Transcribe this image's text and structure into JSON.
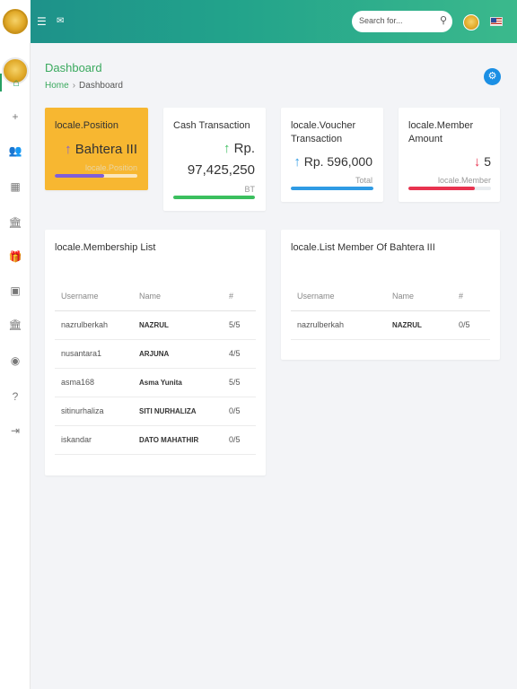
{
  "topbar": {
    "menu_icon": "hamburger-icon",
    "mail_icon": "mail-icon",
    "search_placeholder": "Search for...",
    "search_icon": "search-icon",
    "flag_icon": "us-flag-icon"
  },
  "sidebar": {
    "items": [
      {
        "name": "sidebar-item-home",
        "icon": "home-icon",
        "glyph": "⌂",
        "active": true
      },
      {
        "name": "sidebar-item-add-user",
        "icon": "add-user-icon",
        "glyph": "+",
        "active": false
      },
      {
        "name": "sidebar-item-users",
        "icon": "users-icon",
        "glyph": "👥",
        "active": false
      },
      {
        "name": "sidebar-item-calculator",
        "icon": "calculator-icon",
        "glyph": "▦",
        "active": false
      },
      {
        "name": "sidebar-item-bank",
        "icon": "bank-icon",
        "glyph": "🏛",
        "active": false
      },
      {
        "name": "sidebar-item-gift",
        "icon": "gift-icon",
        "glyph": "🎁",
        "active": false
      },
      {
        "name": "sidebar-item-document",
        "icon": "document-icon",
        "glyph": "▣",
        "active": false
      },
      {
        "name": "sidebar-item-institution",
        "icon": "institution-icon",
        "glyph": "🏛",
        "active": false
      },
      {
        "name": "sidebar-item-account",
        "icon": "account-icon",
        "glyph": "◉",
        "active": false
      },
      {
        "name": "sidebar-item-help",
        "icon": "help-icon",
        "glyph": "?",
        "active": false
      },
      {
        "name": "sidebar-item-logout",
        "icon": "logout-icon",
        "glyph": "⇥",
        "active": false
      }
    ]
  },
  "header": {
    "title": "Dashboard",
    "breadcrumb": {
      "home": "Home",
      "current": "Dashboard"
    },
    "settings_icon": "gear-icon"
  },
  "stats": {
    "position": {
      "title": "locale.Position",
      "value": "Bahtera III",
      "sub": "locale.Position",
      "arrow": "↑",
      "progress": 0.6,
      "color": "#7f5ed8",
      "bg": "#f7b731"
    },
    "cash": {
      "title": "Cash Transaction",
      "value_line1": "Rp.",
      "value_line2": "97,425,250",
      "sub": "BT",
      "arrow": "↑",
      "progress": 1.0,
      "color": "#3bbf5e"
    },
    "voucher": {
      "title": "locale.Voucher Transaction",
      "value": "Rp. 596,000",
      "sub": "Total",
      "arrow": "↑",
      "progress": 1.0,
      "color": "#2f9be4"
    },
    "member": {
      "title": "locale.Member Amount",
      "value": "5",
      "sub": "locale.Member",
      "arrow": "↓",
      "progress": 0.8,
      "color": "#e8334f"
    }
  },
  "membership_list": {
    "title": "locale.Membership List",
    "columns": [
      "Username",
      "Name",
      "#"
    ],
    "rows": [
      {
        "username": "nazrulberkah",
        "name": "NAZRUL",
        "count": "5/5"
      },
      {
        "username": "nusantara1",
        "name": "ARJUNA",
        "count": "4/5"
      },
      {
        "username": "asma168",
        "name": "Asma Yunita",
        "count": "5/5"
      },
      {
        "username": "sitinurhaliza",
        "name": "SITI NURHALIZA",
        "count": "0/5"
      },
      {
        "username": "iskandar",
        "name": "DATO MAHATHIR",
        "count": "0/5"
      }
    ]
  },
  "member_of_list": {
    "title": "locale.List Member Of Bahtera III",
    "columns": [
      "Username",
      "Name",
      "#"
    ],
    "rows": [
      {
        "username": "nazrulberkah",
        "name": "NAZRUL",
        "count": "0/5"
      }
    ]
  }
}
